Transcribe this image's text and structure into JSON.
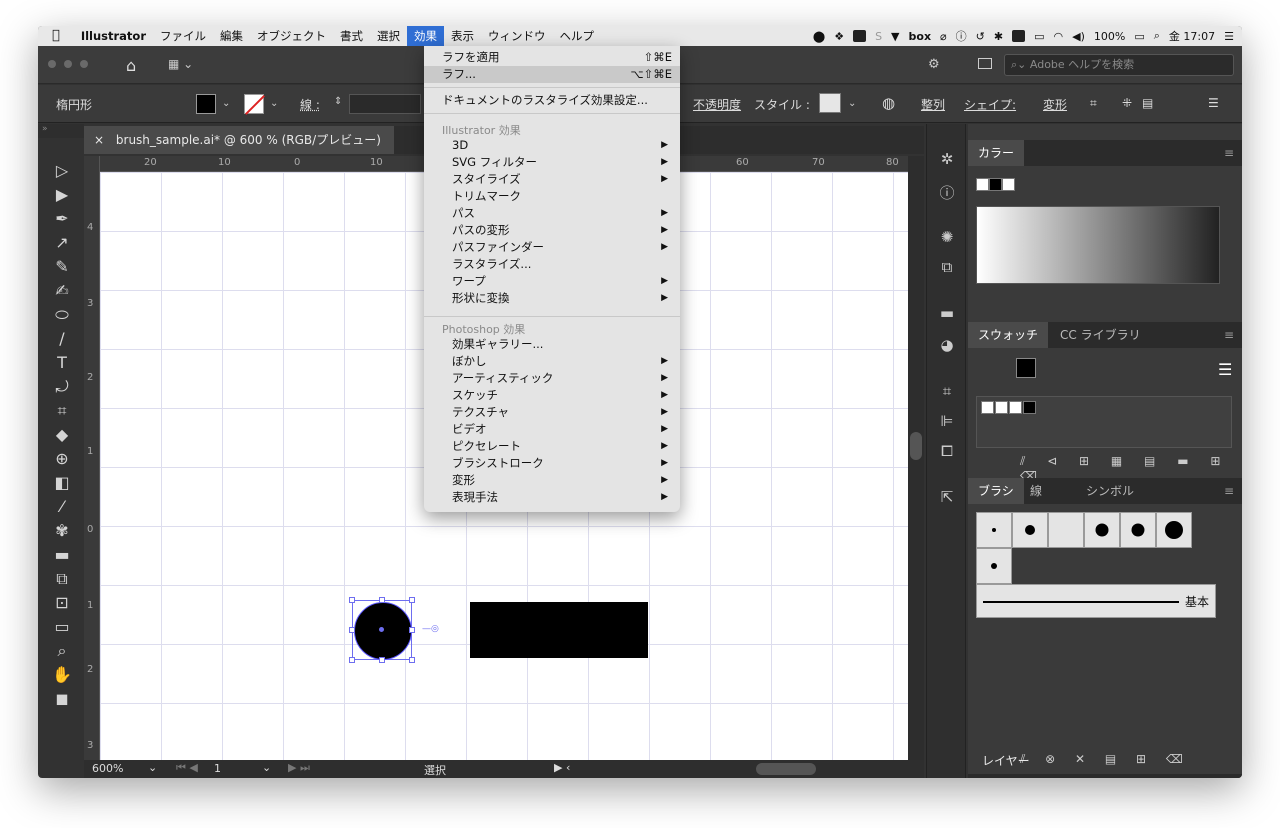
{
  "menubar": {
    "apple": "",
    "app": "Illustrator",
    "items": [
      "ファイル",
      "編集",
      "オブジェクト",
      "書式",
      "選択",
      "効果",
      "表示",
      "ウィンドウ",
      "ヘルプ"
    ],
    "battery": "100%",
    "clock": "金 17:07",
    "box": "box"
  },
  "appbar": {
    "search_placeholder": "Adobe ヘルプを検索"
  },
  "control": {
    "shape_name": "楕円形",
    "stroke_label": "線 :",
    "opacity_label": "不透明度",
    "style_label": "スタイル :",
    "align_label": "整列",
    "shape_label": "シェイプ:",
    "transform_label": "変形"
  },
  "document": {
    "tab_title": "brush_sample.ai* @ 600 % (RGB/プレビュー)",
    "close": "×",
    "ruler_h": [
      "20",
      "10",
      "0",
      "10",
      "60",
      "70",
      "80"
    ],
    "ruler_v": [
      "4",
      "3",
      "2",
      "1",
      "0",
      "1",
      "2",
      "3"
    ]
  },
  "status": {
    "zoom": "600%",
    "page": "1",
    "mode": "選択"
  },
  "effect_menu": {
    "apply_last": "ラフを適用",
    "apply_last_sc": "⇧⌘E",
    "last_effect": "ラフ...",
    "last_effect_sc": "⌥⇧⌘E",
    "raster_settings": "ドキュメントのラスタライズ効果設定...",
    "illustrator_header": "Illustrator 効果",
    "illustrator_items": [
      "3D",
      "SVG フィルター",
      "スタイライズ",
      "トリムマーク",
      "パス",
      "パスの変形",
      "パスファインダー",
      "ラスタライズ...",
      "ワープ",
      "形状に変換"
    ],
    "illustrator_submenu": [
      true,
      true,
      true,
      false,
      true,
      true,
      true,
      false,
      true,
      true
    ],
    "photoshop_header": "Photoshop 効果",
    "photoshop_items": [
      "効果ギャラリー...",
      "ぼかし",
      "アーティスティック",
      "スケッチ",
      "テクスチャ",
      "ビデオ",
      "ピクセレート",
      "ブラシストローク",
      "変形",
      "表現手法"
    ],
    "photoshop_submenu": [
      false,
      true,
      true,
      true,
      true,
      true,
      true,
      true,
      true,
      true
    ]
  },
  "panels": {
    "color_tab": "カラー",
    "swatch_tab": "スウォッチ",
    "cclib_tab": "CC ライブラリ",
    "brush_tab": "ブラシ",
    "stroke_tab": "線",
    "symbol_tab": "シンボル",
    "basic_brush": "基本",
    "layers_tab": "レイヤー"
  },
  "colors": {
    "menubar_active": "#2f6ed4",
    "selection": "#6e6ef0",
    "none_red": "#d22222"
  }
}
